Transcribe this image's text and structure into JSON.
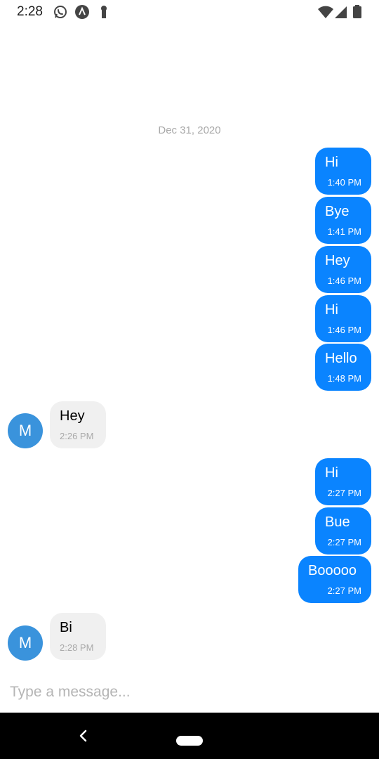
{
  "status_bar": {
    "time": "2:28",
    "icons_left": [
      "whatsapp-icon",
      "nav-app-icon",
      "keyhole-icon"
    ],
    "icons_right": [
      "wifi-icon",
      "signal-icon",
      "battery-icon"
    ]
  },
  "chat": {
    "date_divider": "Dec 31, 2020",
    "messages": [
      {
        "direction": "out",
        "text": "Hi",
        "time": "1:40 PM"
      },
      {
        "direction": "out",
        "text": "Bye",
        "time": "1:41 PM"
      },
      {
        "direction": "out",
        "text": "Hey",
        "time": "1:46 PM"
      },
      {
        "direction": "out",
        "text": "Hi",
        "time": "1:46 PM"
      },
      {
        "direction": "out",
        "text": "Hello",
        "time": "1:48 PM"
      },
      {
        "direction": "in",
        "avatar": "M",
        "text": "Hey",
        "time": "2:26 PM"
      },
      {
        "direction": "out",
        "text": "Hi",
        "time": "2:27 PM"
      },
      {
        "direction": "out",
        "text": "Bue",
        "time": "2:27 PM"
      },
      {
        "direction": "out",
        "text": "Booooo",
        "time": "2:27 PM"
      },
      {
        "direction": "in",
        "avatar": "M",
        "text": "Bi",
        "time": "2:28 PM"
      }
    ]
  },
  "composer": {
    "placeholder": "Type a message..."
  },
  "colors": {
    "outgoing_bubble": "#0a84ff",
    "incoming_bubble": "#f0f0f0",
    "avatar": "#3a93dc"
  }
}
